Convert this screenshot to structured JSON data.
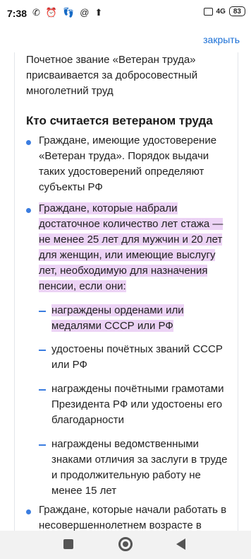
{
  "status_bar": {
    "time": "7:38",
    "signal": "4G",
    "battery": "83",
    "icons": [
      "missed-call-icon",
      "alarm-icon",
      "footprints-icon",
      "at-icon",
      "download-icon"
    ]
  },
  "top_bar": {
    "close_label": "закрыть"
  },
  "article": {
    "intro": "Почетное звание «Ветеран труда» присваивается за добросовестный многолетний труд",
    "heading": "Кто считается ветераном труда",
    "items": [
      {
        "text": "Граждане, имеющие удостоверение «Ветеран труда». Порядок выдачи таких удостоверений определяют субъекты РФ"
      },
      {
        "text": "Граждане, которые набрали достаточное количество лет стажа — не менее 25 лет для мужчин и 20 лет для женщин, или имеющие выслугу лет, необходимую для назначения пенсии, если они:"
      },
      {
        "text": "Граждане, которые начали работать в несовершеннолетнем возрасте в"
      }
    ],
    "subitems": [
      {
        "text": "награждены орденами или медалями СССР или РФ"
      },
      {
        "text": "удостоены почётных званий СССР или РФ"
      },
      {
        "text": "награждены почётными грамотами Президента РФ или удостоены его благодарности"
      },
      {
        "text": "награждены ведомственными знаками отличия за заслуги в труде и продолжительную работу не менее 15 лет"
      }
    ]
  },
  "colors": {
    "accent": "#3b7de0",
    "link": "#1a6fd6",
    "highlight": "#ecd3f5"
  }
}
